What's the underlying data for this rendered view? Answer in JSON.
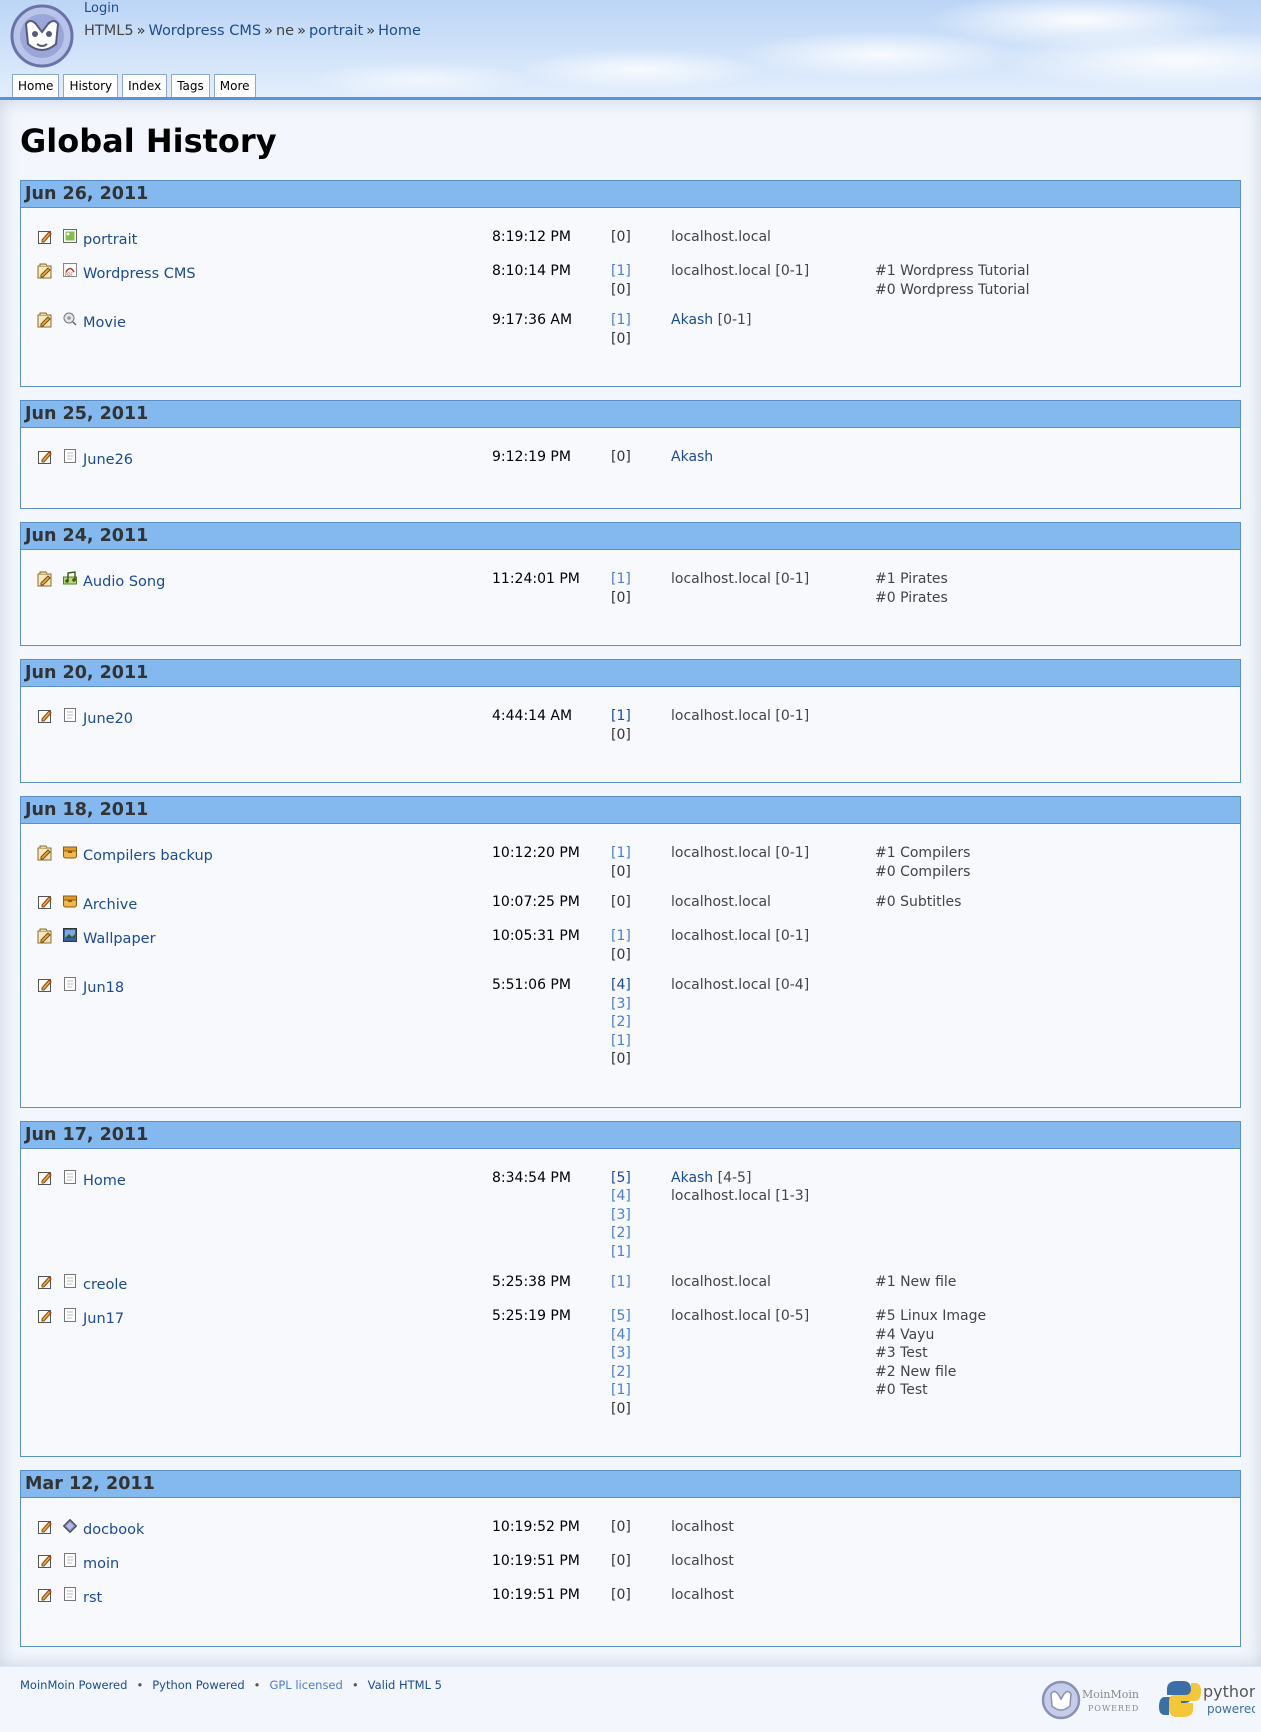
{
  "header": {
    "login": "Login",
    "breadcrumb": [
      "HTML5",
      "Wordpress CMS",
      "ne",
      "portrait",
      "Home"
    ],
    "breadcrumb_sep": "»",
    "tabs": [
      "Home",
      "History",
      "Index",
      "Tags",
      "More"
    ]
  },
  "page": {
    "title": "Global History"
  },
  "days": [
    {
      "date": "Jun 26, 2011",
      "entries": [
        {
          "action": "edit",
          "type": "image",
          "name": "portrait",
          "time": "8:19:12 PM",
          "revs": [
            {
              "t": "[0]",
              "k": "plain"
            }
          ],
          "editors": [
            {
              "t": "localhost.local"
            }
          ],
          "comments": []
        },
        {
          "action": "rename",
          "type": "pdf",
          "name": "Wordpress CMS",
          "time": "8:10:14 PM",
          "revs": [
            {
              "t": "[1]",
              "k": "link"
            },
            {
              "t": "[0]",
              "k": "plain"
            }
          ],
          "editors": [
            {
              "t": "localhost.local [0-1]"
            }
          ],
          "comments": [
            "#1 Wordpress Tutorial",
            "#0 Wordpress Tutorial"
          ]
        },
        {
          "action": "rename",
          "type": "video",
          "name": "Movie",
          "time": "9:17:36 AM",
          "revs": [
            {
              "t": "[1]",
              "k": "link"
            },
            {
              "t": "[0]",
              "k": "plain"
            }
          ],
          "editors": [
            {
              "t": "Akash",
              "link": true,
              "suffix": " [0-1]"
            }
          ],
          "comments": []
        }
      ]
    },
    {
      "date": "Jun 25, 2011",
      "entries": [
        {
          "action": "edit",
          "type": "page",
          "name": "June26",
          "time": "9:12:19 PM",
          "revs": [
            {
              "t": "[0]",
              "k": "plain"
            }
          ],
          "editors": [
            {
              "t": "Akash",
              "link": true
            }
          ],
          "comments": []
        }
      ]
    },
    {
      "date": "Jun 24, 2011",
      "entries": [
        {
          "action": "rename",
          "type": "audio",
          "name": "Audio Song",
          "time": "11:24:01 PM",
          "revs": [
            {
              "t": "[1]",
              "k": "link"
            },
            {
              "t": "[0]",
              "k": "plain"
            }
          ],
          "editors": [
            {
              "t": "localhost.local [0-1]"
            }
          ],
          "comments": [
            "#1 Pirates",
            "#0 Pirates"
          ]
        }
      ]
    },
    {
      "date": "Jun 20, 2011",
      "entries": [
        {
          "action": "edit",
          "type": "page",
          "name": "June20",
          "time": "4:44:14 AM",
          "revs": [
            {
              "t": "[1]",
              "k": "strong"
            },
            {
              "t": "[0]",
              "k": "plain"
            }
          ],
          "editors": [
            {
              "t": "localhost.local [0-1]"
            }
          ],
          "comments": []
        }
      ]
    },
    {
      "date": "Jun 18, 2011",
      "entries": [
        {
          "action": "rename",
          "type": "archive",
          "name": "Compilers backup",
          "time": "10:12:20 PM",
          "revs": [
            {
              "t": "[1]",
              "k": "link"
            },
            {
              "t": "[0]",
              "k": "plain"
            }
          ],
          "editors": [
            {
              "t": "localhost.local [0-1]"
            }
          ],
          "comments": [
            "#1 Compilers",
            "#0 Compilers"
          ]
        },
        {
          "action": "edit",
          "type": "archive",
          "name": "Archive",
          "time": "10:07:25 PM",
          "revs": [
            {
              "t": "[0]",
              "k": "plain"
            }
          ],
          "editors": [
            {
              "t": "localhost.local"
            }
          ],
          "comments": [
            "#0 Subtitles"
          ]
        },
        {
          "action": "rename",
          "type": "picture",
          "name": "Wallpaper",
          "time": "10:05:31 PM",
          "revs": [
            {
              "t": "[1]",
              "k": "link"
            },
            {
              "t": "[0]",
              "k": "plain"
            }
          ],
          "editors": [
            {
              "t": "localhost.local [0-1]"
            }
          ],
          "comments": []
        },
        {
          "action": "edit",
          "type": "page",
          "name": "Jun18",
          "time": "5:51:06 PM",
          "revs": [
            {
              "t": "[4]",
              "k": "strong"
            },
            {
              "t": "[3]",
              "k": "link"
            },
            {
              "t": "[2]",
              "k": "link"
            },
            {
              "t": "[1]",
              "k": "link"
            },
            {
              "t": "[0]",
              "k": "plain"
            }
          ],
          "editors": [
            {
              "t": "localhost.local [0-4]"
            }
          ],
          "comments": []
        }
      ]
    },
    {
      "date": "Jun 17, 2011",
      "entries": [
        {
          "action": "edit",
          "type": "page",
          "name": "Home",
          "time": "8:34:54 PM",
          "revs": [
            {
              "t": "[5]",
              "k": "strong"
            },
            {
              "t": "[4]",
              "k": "link"
            },
            {
              "t": "[3]",
              "k": "link"
            },
            {
              "t": "[2]",
              "k": "link"
            },
            {
              "t": "[1]",
              "k": "link"
            }
          ],
          "editors": [
            {
              "t": "Akash",
              "link": true,
              "suffix": " [4-5]"
            },
            {
              "t": "localhost.local [1-3]"
            }
          ],
          "comments": []
        },
        {
          "action": "edit",
          "type": "page",
          "name": "creole",
          "time": "5:25:38 PM",
          "revs": [
            {
              "t": "[1]",
              "k": "link"
            }
          ],
          "editors": [
            {
              "t": "localhost.local"
            }
          ],
          "comments": [
            "#1 New file"
          ]
        },
        {
          "action": "edit",
          "type": "page",
          "name": "Jun17",
          "time": "5:25:19 PM",
          "revs": [
            {
              "t": "[5]",
              "k": "link"
            },
            {
              "t": "[4]",
              "k": "link"
            },
            {
              "t": "[3]",
              "k": "link"
            },
            {
              "t": "[2]",
              "k": "link"
            },
            {
              "t": "[1]",
              "k": "link"
            },
            {
              "t": "[0]",
              "k": "plain"
            }
          ],
          "editors": [
            {
              "t": "localhost.local [0-5]"
            }
          ],
          "comments": [
            "#5 Linux Image",
            "#4 Vayu",
            "#3 Test",
            "#2 New file",
            "#0 Test"
          ]
        }
      ]
    },
    {
      "date": "Mar 12, 2011",
      "entries": [
        {
          "action": "edit",
          "type": "docbook",
          "name": "docbook",
          "time": "10:19:52 PM",
          "revs": [
            {
              "t": "[0]",
              "k": "plain"
            }
          ],
          "editors": [
            {
              "t": "localhost"
            }
          ],
          "comments": []
        },
        {
          "action": "edit",
          "type": "page",
          "name": "moin",
          "time": "10:19:51 PM",
          "revs": [
            {
              "t": "[0]",
              "k": "plain"
            }
          ],
          "editors": [
            {
              "t": "localhost"
            }
          ],
          "comments": []
        },
        {
          "action": "edit",
          "type": "page",
          "name": "rst",
          "time": "10:19:51 PM",
          "revs": [
            {
              "t": "[0]",
              "k": "plain"
            }
          ],
          "editors": [
            {
              "t": "localhost"
            }
          ],
          "comments": []
        }
      ]
    }
  ],
  "footer": {
    "links": [
      "MoinMoin Powered",
      "Python Powered",
      "GPL licensed",
      "Valid HTML 5"
    ],
    "moin_badge": [
      "MoinMoin",
      "POWERED"
    ],
    "python_badge": [
      "python",
      "powered"
    ]
  }
}
